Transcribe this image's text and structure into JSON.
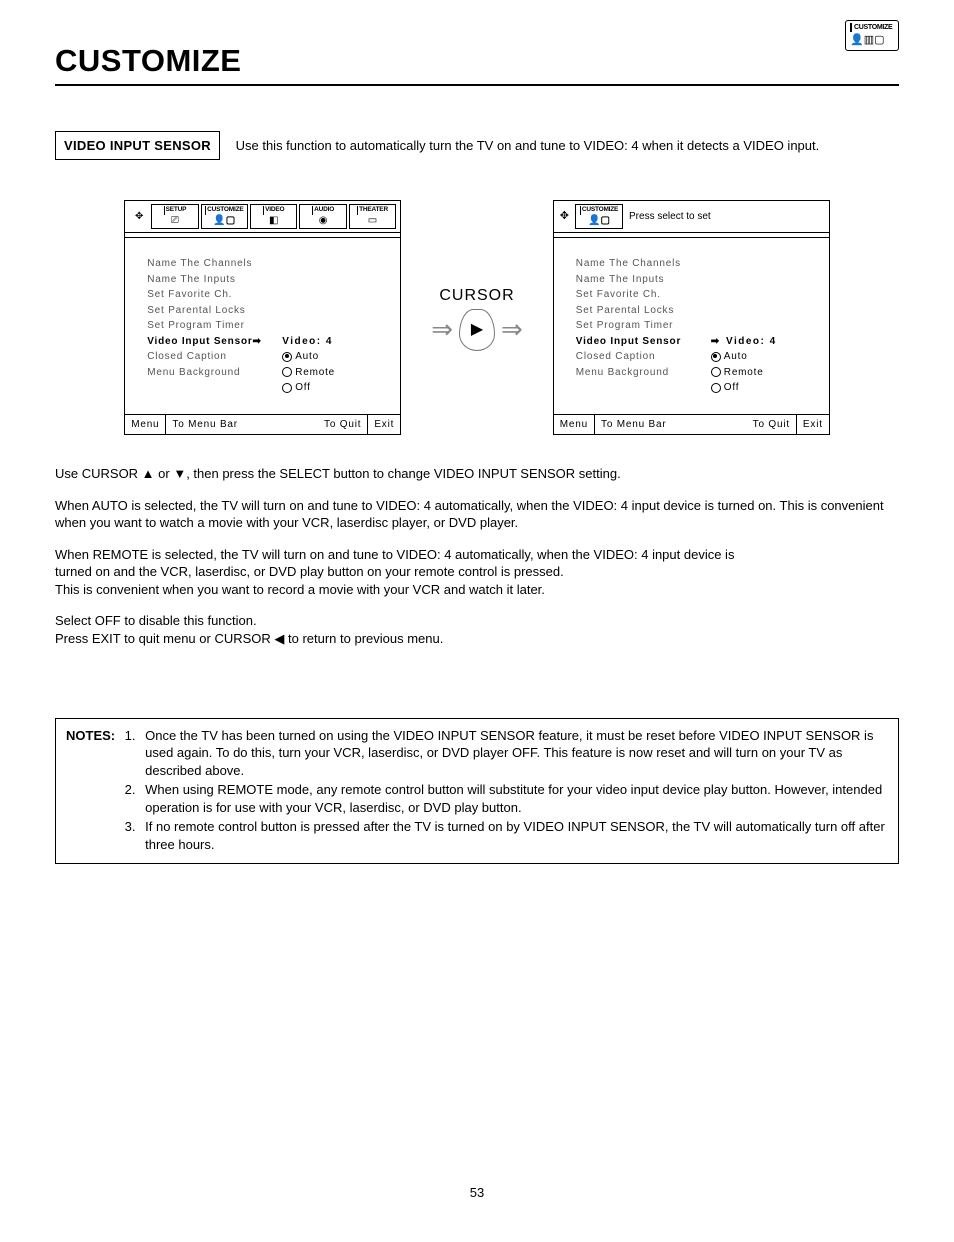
{
  "header": {
    "title": "CUSTOMIZE",
    "corner_label": "CUSTOMIZE"
  },
  "section": {
    "label": "VIDEO INPUT SENSOR",
    "description": "Use this function to automatically turn the TV on and tune to VIDEO: 4 when it detects a VIDEO input."
  },
  "tabs": [
    "SETUP",
    "CUSTOMIZE",
    "VIDEO",
    "AUDIO",
    "THEATER"
  ],
  "panelA": {
    "menu": [
      "Name The Channels",
      "Name The Inputs",
      "Set Favorite Ch.",
      "Set Parental Locks",
      "Set Program Timer",
      "Video Input Sensor",
      "Closed Caption",
      "Menu Background"
    ],
    "value": "Video: 4",
    "radios": [
      "Auto",
      "Remote",
      "Off"
    ],
    "footer": {
      "menu": "Menu",
      "mid": "To Menu Bar",
      "quit": "To Quit",
      "exit": "Exit"
    }
  },
  "panelB": {
    "header_label": "CUSTOMIZE",
    "header_hint": "Press select to set",
    "menu": [
      "Name The Channels",
      "Name The Inputs",
      "Set Favorite Ch.",
      "Set Parental Locks",
      "Set Program Timer",
      "Video Input Sensor",
      "Closed Caption",
      "Menu Background"
    ],
    "value": "Video: 4",
    "radios": [
      "Auto",
      "Remote",
      "Off"
    ],
    "footer": {
      "menu": "Menu",
      "mid": "To Menu Bar",
      "quit": "To Quit",
      "exit": "Exit"
    }
  },
  "cursor_label": "CURSOR",
  "body": {
    "p1": "Use CURSOR ▲ or ▼, then press the SELECT button to change VIDEO INPUT SENSOR setting.",
    "p2": "When AUTO is selected, the TV will turn on and tune to VIDEO: 4 automatically, when the VIDEO: 4 input device is turned on. This is convenient when you want to watch a movie with your VCR, laserdisc player, or DVD player.",
    "p3a": "When REMOTE is selected, the TV will turn on and tune to VIDEO: 4 automatically, when the VIDEO: 4 input device is",
    "p3b": "turned on and the VCR, laserdisc, or DVD play button on your remote control is pressed.",
    "p3c": "This is convenient when you want to record a movie with your VCR and watch it later.",
    "p4a": "Select OFF to disable this function.",
    "p4b": "Press EXIT to quit menu or CURSOR ◀ to return to previous menu."
  },
  "notes": {
    "label": "NOTES:",
    "items": [
      "Once the TV has been turned on using the VIDEO INPUT SENSOR feature, it must be reset before VIDEO INPUT SENSOR is used again. To do this, turn your VCR, laserdisc, or DVD player OFF. This feature is now reset and will turn on your TV as described above.",
      "When using REMOTE mode, any remote control button will substitute for your video input device play button. However, intended operation is for use with your VCR, laserdisc, or DVD play button.",
      "If no remote control button is pressed after the TV is turned on by VIDEO INPUT SENSOR, the TV will automatically turn off after three hours."
    ]
  },
  "page_number": "53"
}
